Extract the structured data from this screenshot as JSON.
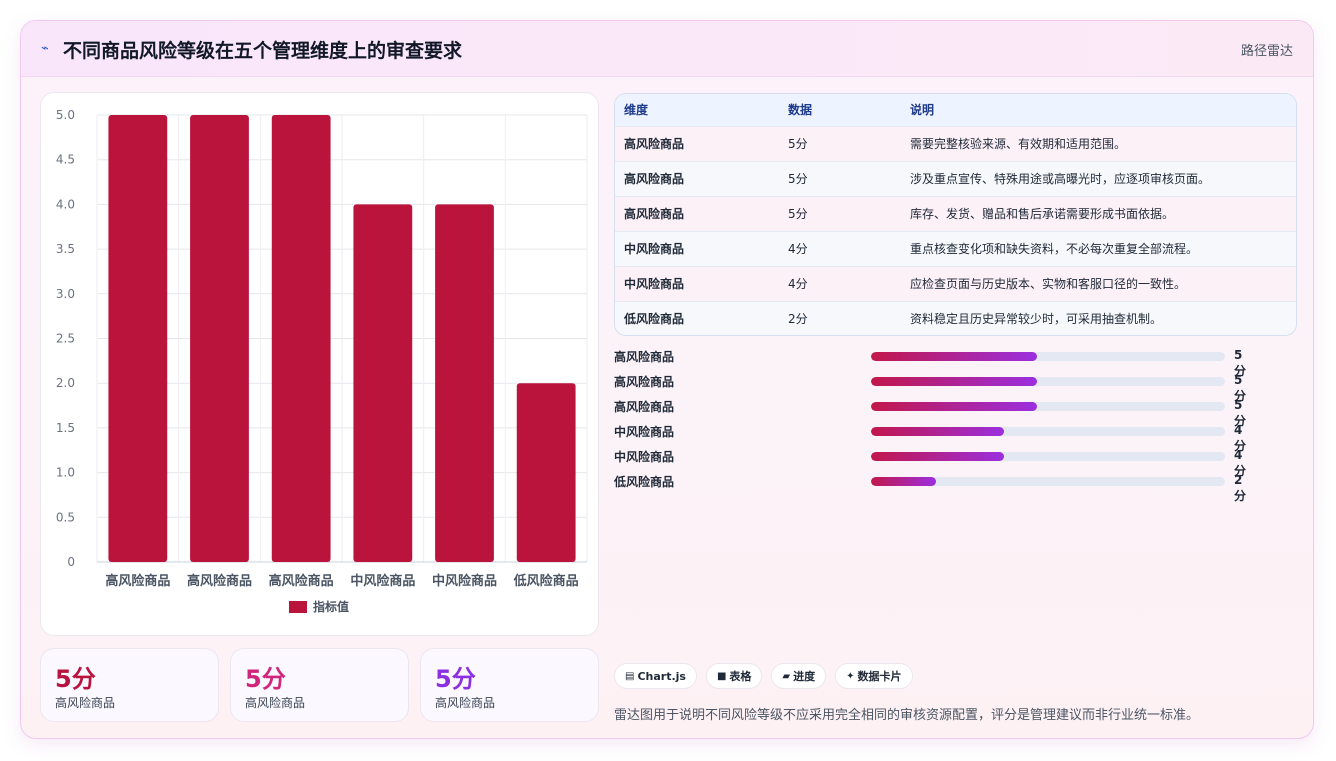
{
  "header": {
    "icon": "line-chart-icon",
    "title": "不同商品风险等级在五个管理维度上的审查要求",
    "right_label": "路径雷达"
  },
  "chart_data": {
    "type": "bar",
    "categories": [
      "高风险商品",
      "高风险商品",
      "高风险商品",
      "中风险商品",
      "中风险商品",
      "低风险商品"
    ],
    "series": [
      {
        "name": "指标值",
        "values": [
          5,
          5,
          5,
          4,
          4,
          2
        ],
        "color": "#bb143c"
      }
    ],
    "y_ticks": [
      "0",
      "0.5",
      "1.0",
      "1.5",
      "2.0",
      "2.5",
      "3.0",
      "3.5",
      "4.0",
      "4.5",
      "5.0"
    ],
    "ylim": [
      0,
      5
    ],
    "grid": true,
    "legend": "bottom"
  },
  "stats": [
    {
      "value": "5分",
      "label": "高风险商品",
      "color": "#b8123e"
    },
    {
      "value": "5分",
      "label": "高风险商品",
      "color": "#d0257a"
    },
    {
      "value": "5分",
      "label": "高风险商品",
      "color": "#8b2fe0"
    }
  ],
  "table": {
    "headers": [
      "维度",
      "数据",
      "说明"
    ],
    "rows": [
      [
        "高风险商品",
        "5分",
        "需要完整核验来源、有效期和适用范围。"
      ],
      [
        "高风险商品",
        "5分",
        "涉及重点宣传、特殊用途或高曝光时，应逐项审核页面。"
      ],
      [
        "高风险商品",
        "5分",
        "库存、发货、赠品和售后承诺需要形成书面依据。"
      ],
      [
        "中风险商品",
        "4分",
        "重点核查变化项和缺失资料，不必每次重复全部流程。"
      ],
      [
        "中风险商品",
        "4分",
        "应检查页面与历史版本、实物和客服口径的一致性。"
      ],
      [
        "低风险商品",
        "2分",
        "资料稳定且历史异常较少时，可采用抽查机制。"
      ]
    ]
  },
  "progress": [
    {
      "label": "高风险商品",
      "value_text": "5分",
      "fraction": 0.47
    },
    {
      "label": "高风险商品",
      "value_text": "5分",
      "fraction": 0.47
    },
    {
      "label": "高风险商品",
      "value_text": "5分",
      "fraction": 0.47
    },
    {
      "label": "中风险商品",
      "value_text": "4分",
      "fraction": 0.375
    },
    {
      "label": "中风险商品",
      "value_text": "4分",
      "fraction": 0.375
    },
    {
      "label": "低风险商品",
      "value_text": "2分",
      "fraction": 0.185
    }
  ],
  "chips": [
    {
      "icon": "▤",
      "label": "Chart.js"
    },
    {
      "icon": "■",
      "label": "表格"
    },
    {
      "icon": "▰",
      "label": "进度"
    },
    {
      "icon": "✦",
      "label": "数据卡片"
    }
  ],
  "note": "雷达图用于说明不同风险等级不应采用完全相同的审核资源配置，评分是管理建议而非行业统一标准。"
}
